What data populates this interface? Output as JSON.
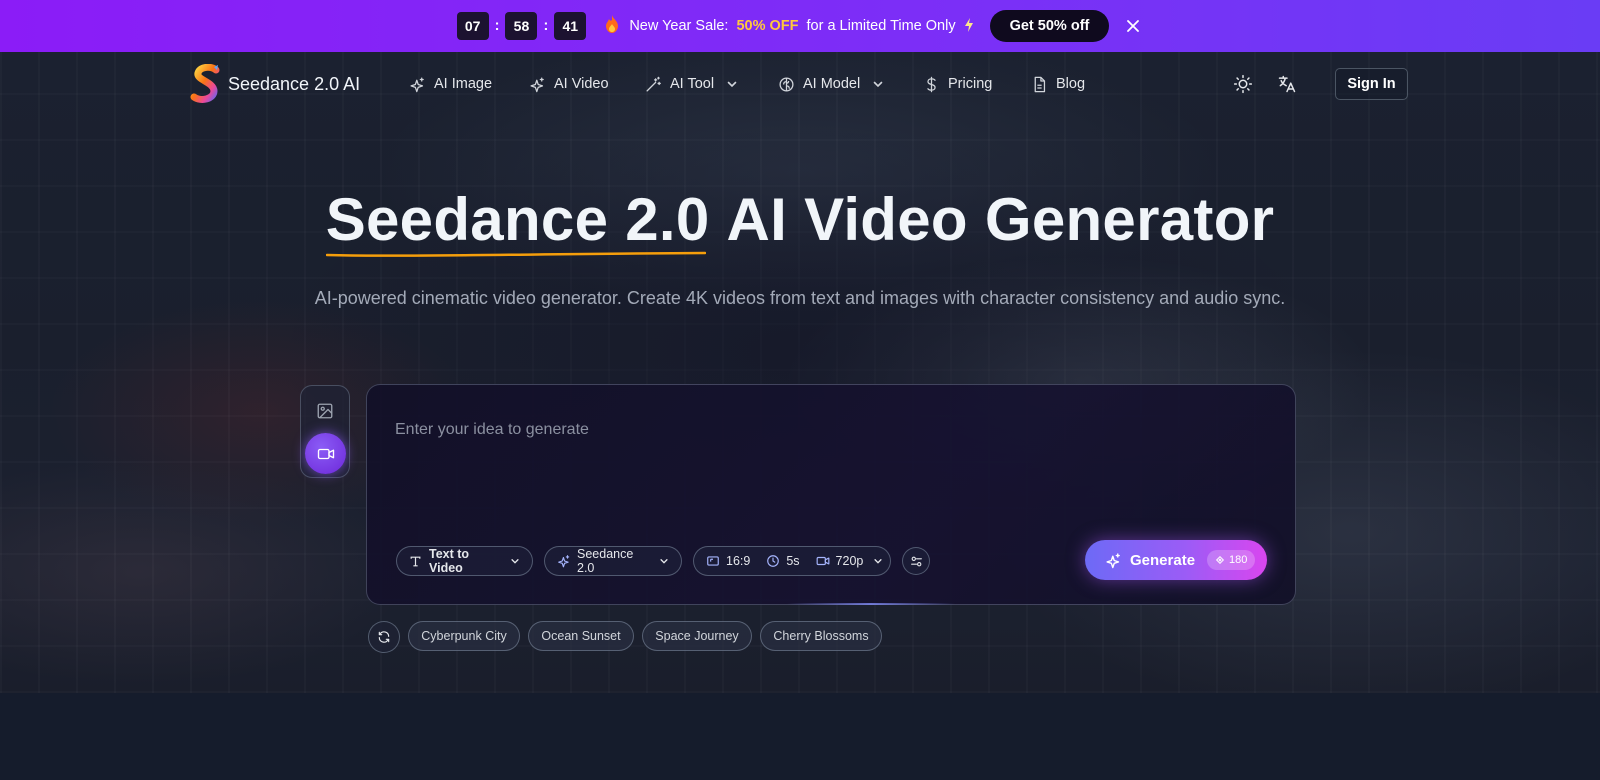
{
  "promo": {
    "countdown": {
      "hours": "07",
      "minutes": "58",
      "seconds": "41",
      "separator": ":"
    },
    "sale_label": "New Year Sale:",
    "sale_highlight": "50% OFF",
    "sale_suffix": "for a Limited Time Only",
    "cta": "Get 50% off",
    "icons": {
      "fire": "fire-icon",
      "bolt": "bolt-icon",
      "close": "close-icon"
    },
    "colors": {
      "bg_start": "#8b1cf7",
      "bg_end": "#6a3cf5",
      "highlight": "#ffc83d"
    }
  },
  "nav": {
    "brand": "Seedance 2.0 AI",
    "items": [
      {
        "label": "AI Image",
        "icon": "sparkles-icon",
        "has_dropdown": false
      },
      {
        "label": "AI Video",
        "icon": "sparkles-icon",
        "has_dropdown": false
      },
      {
        "label": "AI Tool",
        "icon": "magic-wand-icon",
        "has_dropdown": true
      },
      {
        "label": "AI Model",
        "icon": "brain-icon",
        "has_dropdown": true
      },
      {
        "label": "Pricing",
        "icon": "dollar-icon",
        "has_dropdown": false
      },
      {
        "label": "Blog",
        "icon": "document-icon",
        "has_dropdown": false
      }
    ],
    "theme_toggle_icon": "sun-icon",
    "language_icon": "translate-icon",
    "sign_in": "Sign In"
  },
  "hero": {
    "title_highlight": "Seedance 2.0",
    "title_rest": " AI Video Generator",
    "subtitle": "AI-powered cinematic video generator. Create 4K videos from text and images with character consistency and audio sync.",
    "underline_color": "#f59e0b"
  },
  "generator": {
    "modes": [
      {
        "name": "image",
        "icon": "image-icon",
        "active": false
      },
      {
        "name": "video",
        "icon": "video-camera-icon",
        "active": true
      }
    ],
    "prompt_value": "",
    "prompt_placeholder": "Enter your idea to generate",
    "mode_select": "Text to Video",
    "model_select": "Seedance 2.0",
    "aspect_ratio": "16:9",
    "duration": "5s",
    "resolution": "720p",
    "generate_label": "Generate",
    "credits": "180",
    "accent": "#8b5cf6"
  },
  "suggestions": [
    "Cyberpunk City",
    "Ocean Sunset",
    "Space Journey",
    "Cherry Blossoms"
  ]
}
